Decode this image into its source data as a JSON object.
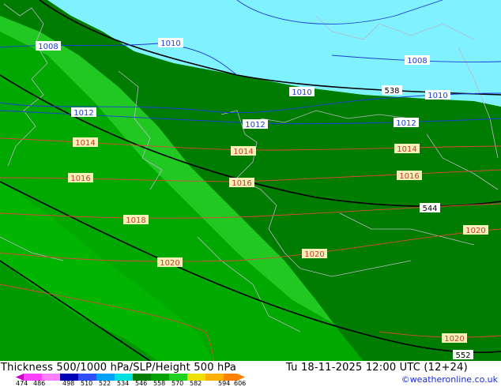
{
  "map": {
    "isobar_labels": [
      {
        "text": "1008",
        "type": "slp-blue"
      },
      {
        "text": "1010",
        "type": "slp-blue"
      },
      {
        "text": "1008",
        "type": "slp-blue"
      },
      {
        "text": "1010",
        "type": "slp-blue"
      },
      {
        "text": "1010",
        "type": "slp-blue"
      },
      {
        "text": "1012",
        "type": "slp-blue"
      },
      {
        "text": "1012",
        "type": "slp-blue"
      },
      {
        "text": "1012",
        "type": "slp-blue"
      },
      {
        "text": "1014",
        "type": "slp-red"
      },
      {
        "text": "1014",
        "type": "slp-red"
      },
      {
        "text": "1014",
        "type": "slp-red"
      },
      {
        "text": "1016",
        "type": "slp-red"
      },
      {
        "text": "1016",
        "type": "slp-red"
      },
      {
        "text": "1016",
        "type": "slp-red"
      },
      {
        "text": "1018",
        "type": "slp-red"
      },
      {
        "text": "1020",
        "type": "slp-red"
      },
      {
        "text": "1020",
        "type": "slp-red"
      },
      {
        "text": "1020",
        "type": "slp-red"
      },
      {
        "text": "1020",
        "type": "slp-red"
      }
    ],
    "height_labels": [
      "538",
      "544",
      "552"
    ],
    "colors": {
      "sea": "#80f2ff",
      "thickness_dark": "#007c00",
      "thickness_mid": "#009800",
      "thickness_light": "#00b400",
      "thickness_lightest": "#22c822",
      "isobar_low": "#1b3ed6",
      "isobar_high": "#d84a3a",
      "height": "#000000",
      "borders": "#b8b8c8",
      "label_high_bg": "#f8f0b8",
      "label_low_bg": "#ffffff"
    }
  },
  "footer": {
    "title_left": "Thickness 500/1000 hPa/SLP/Height 500 hPa",
    "title_right": "Tu 18-11-2025 12:00 UTC (12+24)",
    "copyright": "©weatheronline.co.uk",
    "scale_ticks": [
      "474",
      "486",
      "498",
      "510",
      "522",
      "534",
      "546",
      "558",
      "570",
      "582",
      "594",
      "606"
    ],
    "scale_colors": [
      "#c800c8",
      "#ff40ff",
      "#0000b4",
      "#3050ff",
      "#00a0ff",
      "#00e0e0",
      "#007c00",
      "#00a000",
      "#20d020",
      "#f0e000",
      "#ffb000",
      "#ff8000"
    ]
  }
}
